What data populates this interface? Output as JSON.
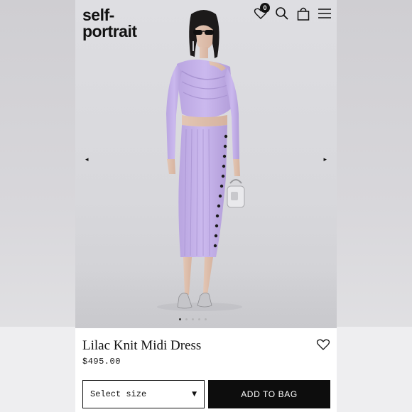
{
  "brand": {
    "logo_line1": "self-",
    "logo_line2": "portrait"
  },
  "header": {
    "wishlist_count": "0",
    "icons": [
      "heart-icon",
      "search-icon",
      "shopping-bag-icon",
      "menu-icon"
    ]
  },
  "gallery": {
    "prev_arrow": "◂",
    "next_arrow": "▸",
    "slide_count": 5,
    "active_slide": 1
  },
  "product": {
    "name": "Lilac Knit Midi Dress",
    "price": "$495.00",
    "color": "#c6b3ea"
  },
  "actions": {
    "size_select_label": "Select size",
    "size_caret": "▼",
    "add_to_bag_label": "ADD TO BAG"
  }
}
